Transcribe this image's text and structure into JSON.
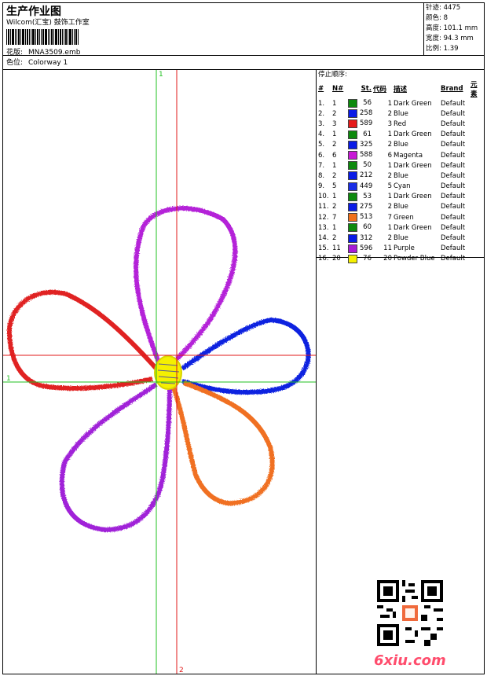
{
  "header": {
    "title": "生产作业图",
    "company": "Wilcom(汇宝) 鼓饰工作室",
    "design_label": "花版:",
    "design_value": "MNA3509.emb",
    "colorway_label": "色位:",
    "colorway_value": "Colorway 1"
  },
  "stats": [
    {
      "label": "针迹:",
      "value": "4475"
    },
    {
      "label": "颜色:",
      "value": "8"
    },
    {
      "label": "高度:",
      "value": "101.1 mm"
    },
    {
      "label": "宽度:",
      "value": "94.3 mm"
    },
    {
      "label": "比例:",
      "value": "1.39"
    }
  ],
  "stop_sequence": {
    "title": "停止顺序:",
    "columns": [
      "#",
      "N#",
      "St.",
      "代码",
      "描述",
      "Brand",
      "元素"
    ],
    "rows": [
      {
        "idx": "1.",
        "n": "1",
        "color": "#0d8a0d",
        "st": "56",
        "code": "1",
        "desc": "Dark Green",
        "brand": "Default"
      },
      {
        "idx": "2.",
        "n": "2",
        "color": "#0a1be6",
        "st": "258",
        "code": "2",
        "desc": "Blue",
        "brand": "Default"
      },
      {
        "idx": "3.",
        "n": "3",
        "color": "#e61a1a",
        "st": "589",
        "code": "3",
        "desc": "Red",
        "brand": "Default"
      },
      {
        "idx": "4.",
        "n": "1",
        "color": "#0d8a0d",
        "st": "61",
        "code": "1",
        "desc": "Dark Green",
        "brand": "Default"
      },
      {
        "idx": "5.",
        "n": "2",
        "color": "#0a1be6",
        "st": "325",
        "code": "2",
        "desc": "Blue",
        "brand": "Default"
      },
      {
        "idx": "6.",
        "n": "6",
        "color": "#c81ad6",
        "st": "588",
        "code": "6",
        "desc": "Magenta",
        "brand": "Default"
      },
      {
        "idx": "7.",
        "n": "1",
        "color": "#0d8a0d",
        "st": "50",
        "code": "1",
        "desc": "Dark Green",
        "brand": "Default"
      },
      {
        "idx": "8.",
        "n": "2",
        "color": "#0a1be6",
        "st": "212",
        "code": "2",
        "desc": "Blue",
        "brand": "Default"
      },
      {
        "idx": "9.",
        "n": "5",
        "color": "#1a2ee6",
        "st": "449",
        "code": "5",
        "desc": "Cyan",
        "brand": "Default"
      },
      {
        "idx": "10.",
        "n": "1",
        "color": "#0d8a0d",
        "st": "53",
        "code": "1",
        "desc": "Dark Green",
        "brand": "Default"
      },
      {
        "idx": "11.",
        "n": "2",
        "color": "#0a1be6",
        "st": "275",
        "code": "2",
        "desc": "Blue",
        "brand": "Default"
      },
      {
        "idx": "12.",
        "n": "7",
        "color": "#f0701a",
        "st": "513",
        "code": "7",
        "desc": "Green",
        "brand": "Default"
      },
      {
        "idx": "13.",
        "n": "1",
        "color": "#0d8a0d",
        "st": "60",
        "code": "1",
        "desc": "Dark Green",
        "brand": "Default"
      },
      {
        "idx": "14.",
        "n": "2",
        "color": "#0a1be6",
        "st": "312",
        "code": "2",
        "desc": "Blue",
        "brand": "Default"
      },
      {
        "idx": "15.",
        "n": "11",
        "color": "#a81ad6",
        "st": "596",
        "code": "11",
        "desc": "Purple",
        "brand": "Default"
      },
      {
        "idx": "16.",
        "n": "20",
        "color": "#f5f000",
        "st": "76",
        "code": "20",
        "desc": "Powder Blue",
        "brand": "Default"
      }
    ]
  },
  "guides": {
    "h_label": "1",
    "v_top_label": "1",
    "v_bottom_label": "2"
  },
  "watermark": "6xiu.com",
  "colors": {
    "guide_green": "#22c022",
    "guide_red": "#e01818",
    "petal_purple": "#b420d8",
    "petal_red": "#e02020",
    "petal_blue": "#1020e0",
    "petal_orange": "#f07020",
    "petal_violet": "#a020d8",
    "center_yellow": "#f5f000"
  }
}
